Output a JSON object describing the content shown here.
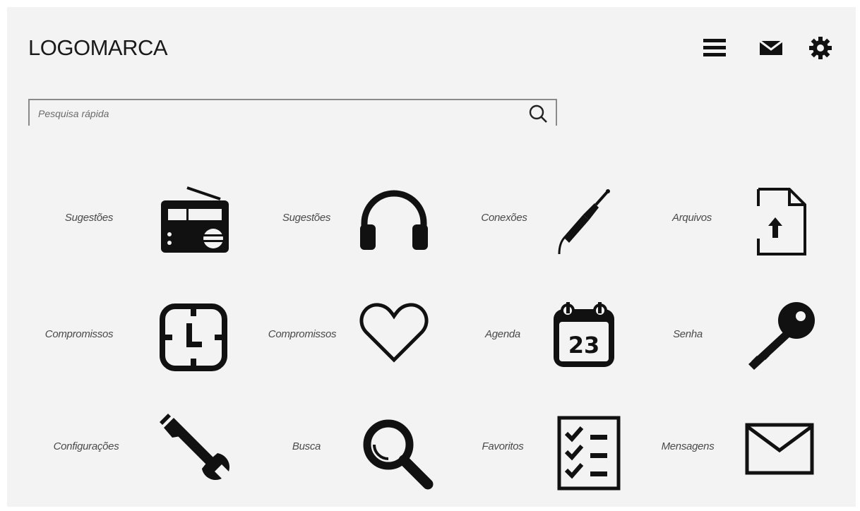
{
  "header": {
    "logo": "LOGOMARCA",
    "icons": [
      "menu-icon",
      "mail-icon",
      "gear-icon"
    ]
  },
  "search": {
    "placeholder": "Pesquisa rápida",
    "icon": "search-icon"
  },
  "grid": [
    {
      "label": "Sugestões",
      "icon": "radio-icon"
    },
    {
      "label": "Sugestões",
      "icon": "headphones-icon"
    },
    {
      "label": "Conexões",
      "icon": "audio-jack-icon"
    },
    {
      "label": "Arquivos",
      "icon": "file-upload-icon"
    },
    {
      "label": "Compromissos",
      "icon": "clock-icon"
    },
    {
      "label": "Compromissos",
      "icon": "heart-icon"
    },
    {
      "label": "Agenda",
      "icon": "calendar-icon",
      "calendar_day": "23"
    },
    {
      "label": "Senha",
      "icon": "key-icon"
    },
    {
      "label": "Configurações",
      "icon": "wrench-icon"
    },
    {
      "label": "Busca",
      "icon": "magnifier-icon"
    },
    {
      "label": "Favoritos",
      "icon": "checklist-icon"
    },
    {
      "label": "Mensagens",
      "icon": "envelope-icon"
    }
  ]
}
